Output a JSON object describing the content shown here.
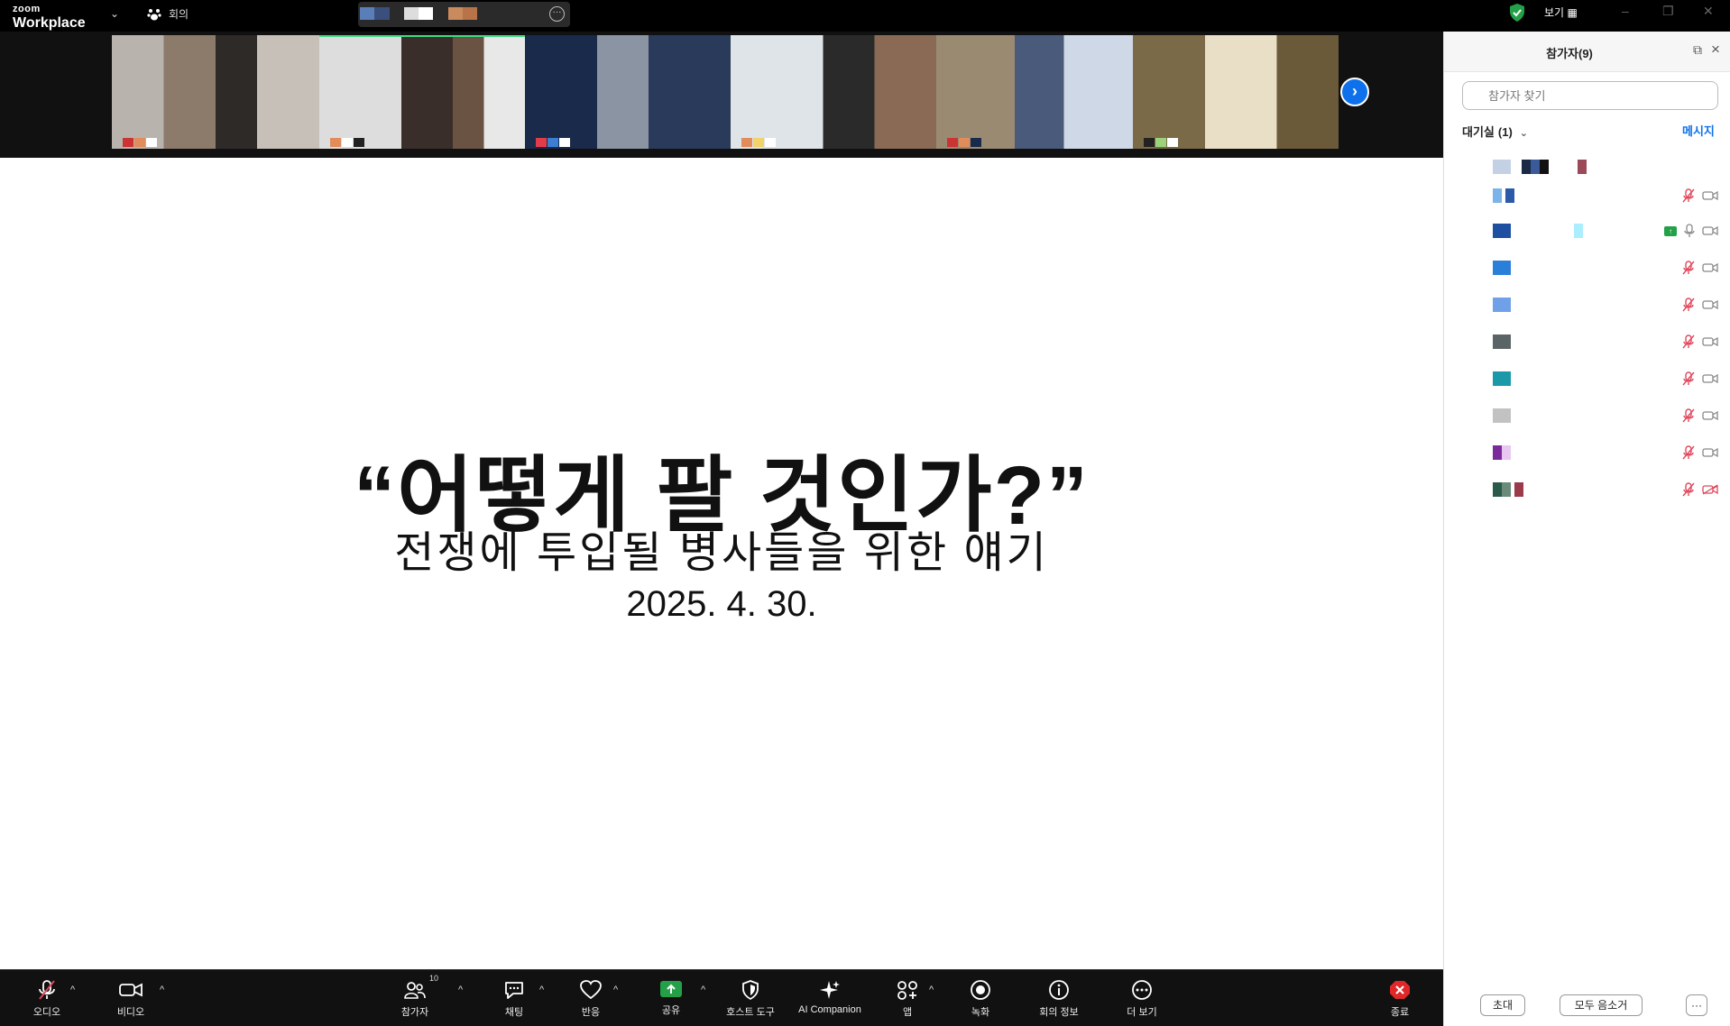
{
  "app": {
    "brand_top": "zoom",
    "brand_main": "Workplace",
    "meeting_label": "회의",
    "view_label": "보기"
  },
  "panel": {
    "title": "참가자(9)",
    "search_placeholder": "참가자 찾기",
    "waiting_room": "대기실",
    "waiting_count": "(1)",
    "message": "메시지",
    "invite": "초대",
    "mute_all": "모두 음소거",
    "more": "···"
  },
  "slide": {
    "title": "“어떻게 팔 것인가?”",
    "subtitle": "전쟁에 투입될 병사들을 위한 얘기",
    "date": "2025. 4. 30."
  },
  "toolbar": {
    "audio": "오디오",
    "video": "비디오",
    "participants": "참가자",
    "participants_count": "10",
    "chat": "채팅",
    "reactions": "반응",
    "share": "공유",
    "host_tools": "호스트 도구",
    "ai_companion": "AI Companion",
    "apps": "앱",
    "record": "녹화",
    "meeting_info": "회의 정보",
    "more": "더 보기",
    "end": "종료"
  },
  "colors": {
    "accent": "#0e71eb",
    "share_green": "#24a148",
    "end_red": "#e02828",
    "muted_red": "#e0475b"
  }
}
